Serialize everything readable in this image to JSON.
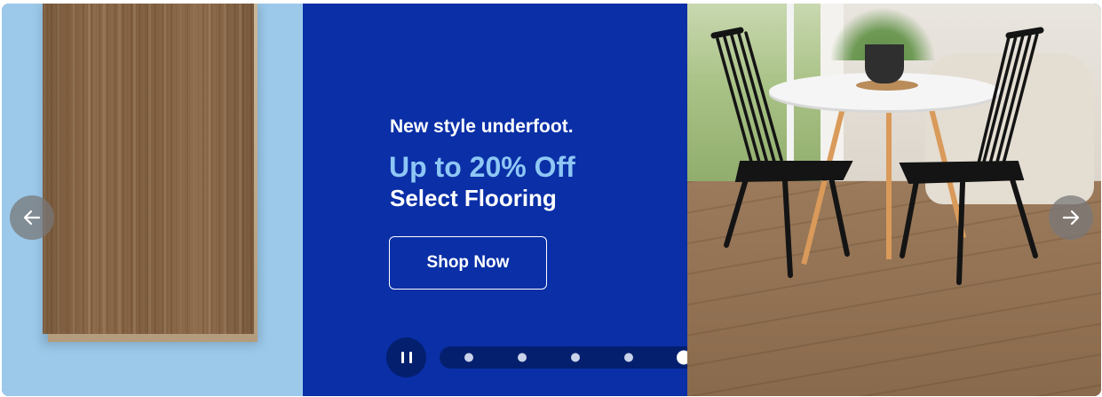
{
  "hero": {
    "tagline": "New style underfoot.",
    "offer": "Up to 20% Off",
    "offer_sub": "Select Flooring",
    "cta_label": "Shop Now"
  },
  "carousel": {
    "prev_icon": "arrow-left-icon",
    "next_icon": "arrow-right-icon",
    "pause_icon": "pause-icon",
    "slide_count": 5,
    "active_slide": 5
  },
  "colors": {
    "brand_blue": "#0a2fa6",
    "accent_blue": "#8ec7f5",
    "left_bg": "#9cc9ea",
    "control_bg": "#041f6e"
  }
}
